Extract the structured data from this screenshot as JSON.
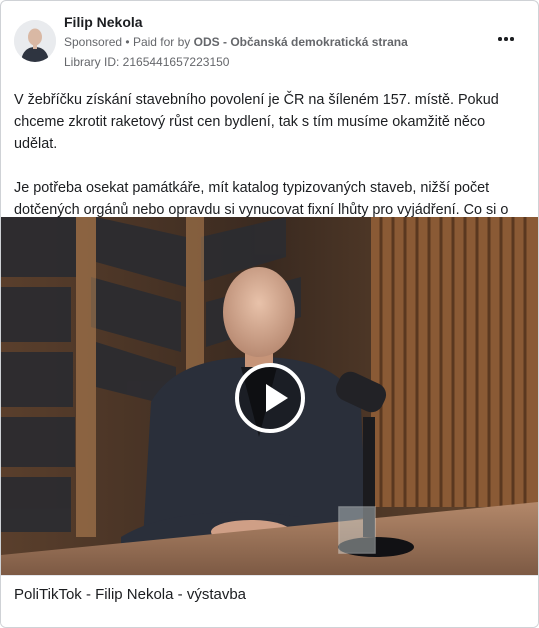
{
  "post": {
    "author_name": "Filip Nekola",
    "sponsored_label": "Sponsored",
    "separator": "•",
    "paid_for_prefix": "Paid for by",
    "paid_for_by": "ODS - Občanská demokratická strana",
    "library_id": "Library ID: 2165441657223150",
    "paragraphs": [
      "V žebříčku získání stavebního povolení je ČR na šíleném 157. místě. Pokud chceme zkrotit raketový růst cen bydlení, tak s tím musíme okamžitě něco udělat.",
      "Je potřeba osekat památkáře, mít katalog typizovaných staveb, nižší počet dotčených orgánů nebo opravdu si vynucovat fixní lhůty pro vyjádření. Co si o tom myslíte?"
    ],
    "media_caption": "PoliTikTok - Filip Nekola - výstavba"
  },
  "icons": {
    "more": "more-options-icon",
    "play": "play-icon"
  },
  "colors": {
    "text_primary": "#1c1e21",
    "text_secondary": "#65676b",
    "border": "#cfd2d6"
  }
}
